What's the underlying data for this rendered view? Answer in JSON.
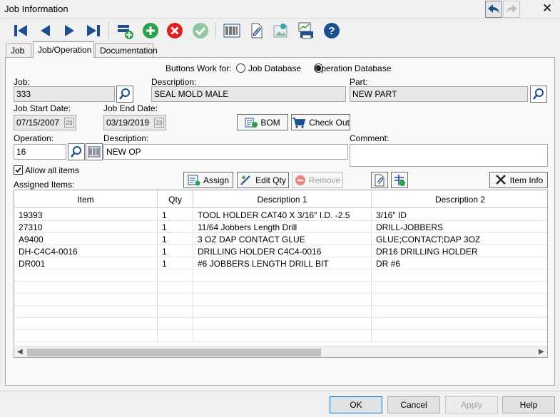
{
  "window": {
    "title": "Job Information"
  },
  "toolbar": {
    "icons": [
      "first-record-icon",
      "previous-record-icon",
      "next-record-icon",
      "last-record-icon",
      "add-row-icon",
      "add-icon",
      "delete-icon",
      "save-check-icon",
      "barcode-icon",
      "attach-icon",
      "image-icon",
      "print-report-icon",
      "help-icon"
    ]
  },
  "tabs": {
    "job": "Job",
    "job_operation": "Job/Operation",
    "documentation": "Documentation"
  },
  "buttons_work_for": {
    "label": "Buttons Work for:",
    "options": [
      {
        "label": "Job Database",
        "selected": false
      },
      {
        "label": "Operation Database",
        "selected": true
      }
    ]
  },
  "job": {
    "job_label": "Job:",
    "job_value": "333",
    "description_label": "Description:",
    "description_value": "SEAL MOLD MALE",
    "part_label": "Part:",
    "part_value": "NEW PART",
    "start_label": "Job Start Date:",
    "start_value": "07/15/2007",
    "end_label": "Job End Date:",
    "end_value": "03/19/2019",
    "bom_label": "BOM",
    "checkout_label": "Check Out"
  },
  "operation": {
    "op_label": "Operation:",
    "op_value": "16",
    "description_label": "Description:",
    "description_value": "NEW OP",
    "comment_label": "Comment:",
    "comment_value": "",
    "allow_all_label": "Allow all items",
    "allow_all_checked": true
  },
  "items_toolbar": {
    "assigned_label": "Assigned Items:",
    "assign": "Assign",
    "edit_qty": "Edit Qty",
    "remove": "Remove",
    "item_info": "Item Info"
  },
  "grid": {
    "columns": [
      "Item",
      "Qty",
      "Description 1",
      "Description 2"
    ],
    "rows": [
      [
        "19393",
        "1",
        "TOOL HOLDER CAT40 X 3/16\" I.D. -2.5",
        "3/16\" ID"
      ],
      [
        "27310",
        "1",
        "11/64 Jobbers Length Drill",
        "DRILL-JOBBERS"
      ],
      [
        "A9400",
        "1",
        "3 OZ DAP CONTACT GLUE",
        "GLUE;CONTACT;DAP 3OZ"
      ],
      [
        "DH-C4C4-0016",
        "1",
        "DRILLING HOLDER C4C4-0016",
        "DR16 DRILLING HOLDER"
      ],
      [
        "DR001",
        "1",
        "#6  JOBBERS LENGTH DRILL BIT",
        "DR #6"
      ]
    ]
  },
  "footer": {
    "ok": "OK",
    "cancel": "Cancel",
    "apply": "Apply",
    "help": "Help"
  },
  "colors": {
    "accent_blue": "#1c4f8f",
    "green": "#2aa14a",
    "red": "#e02020"
  }
}
